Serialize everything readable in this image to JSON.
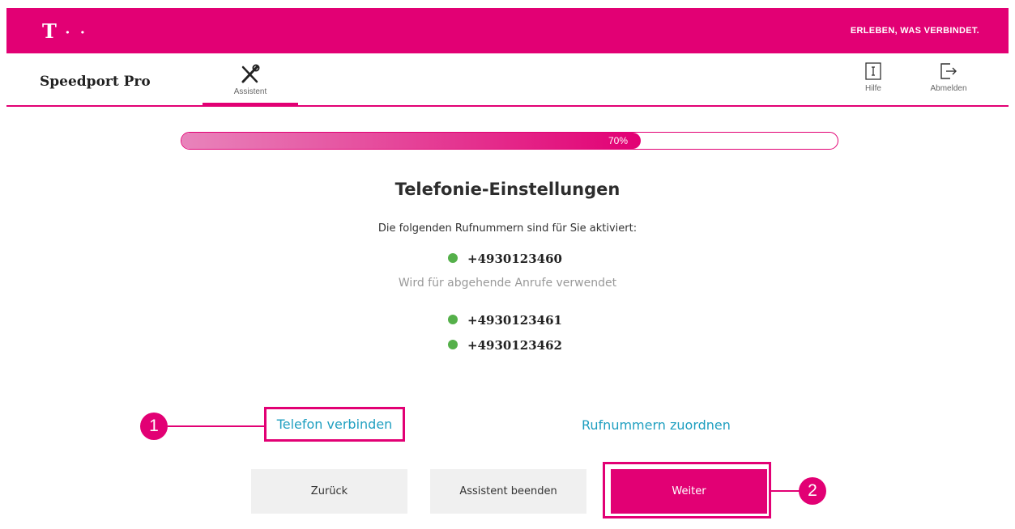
{
  "header": {
    "logo_text": "T",
    "logo_dots": "· ·",
    "slogan": "ERLEBEN, WAS VERBINDET."
  },
  "nav": {
    "brand": "Speedport Pro",
    "tab_label": "Assistent",
    "help_label": "Hilfe",
    "logout_label": "Abmelden"
  },
  "progress": {
    "value": 0.7,
    "label": "70%"
  },
  "main": {
    "title": "Telefonie-Einstellungen",
    "subtitle": "Die folgenden Rufnummern sind für Sie aktiviert:",
    "numbers": [
      {
        "number": "+4930123460",
        "note": "Wird für abgehende Anrufe verwendet",
        "status": "active"
      },
      {
        "number": "+4930123461",
        "status": "active"
      },
      {
        "number": "+4930123462",
        "status": "active"
      }
    ]
  },
  "links": {
    "connect_phone": "Telefon verbinden",
    "assign_numbers": "Rufnummern zuordnen"
  },
  "buttons": {
    "back": "Zurück",
    "end_assistant": "Assistent beenden",
    "next": "Weiter"
  },
  "markers": {
    "one": "1",
    "two": "2"
  },
  "colors": {
    "brand": "#e20074",
    "link": "#1f9fc0",
    "active_dot": "#55b04a"
  }
}
